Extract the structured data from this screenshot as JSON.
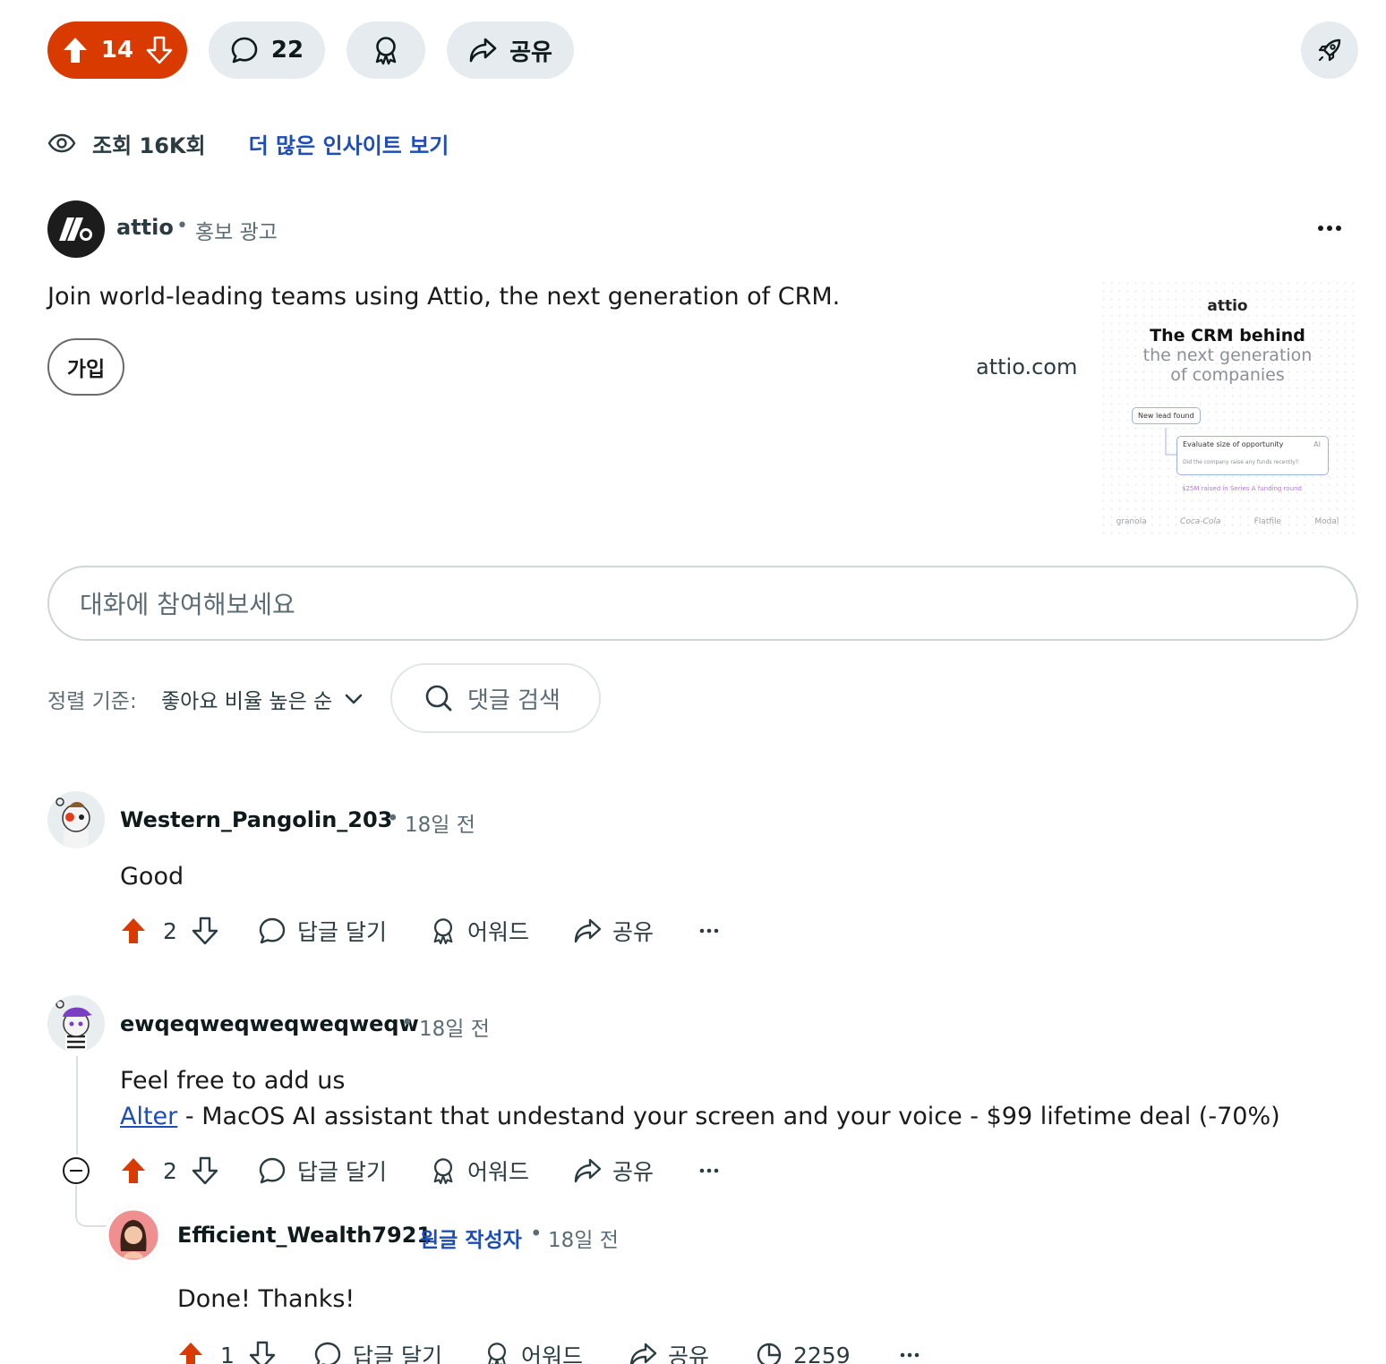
{
  "post_actions": {
    "score": "14",
    "comments_count": "22",
    "share_label": "공유"
  },
  "insights": {
    "views": "조회 16K회",
    "more_insights": "더 많은 인사이트 보기"
  },
  "ad": {
    "advertiser": "attio",
    "separator": "•",
    "promo_label": "홍보 광고",
    "body": "Join world-leading teams using Attio, the next generation of CRM.",
    "cta_label": "가입",
    "domain": "attio.com",
    "creative": {
      "logo": "attio",
      "headline_1": "The CRM behind",
      "headline_2": "the next generation",
      "headline_3": "of companies",
      "box_1": "New lead found",
      "box_2": "Evaluate size of opportunity",
      "box_2_tag": "AI",
      "box_2_question": "Did the company raise any funds recently?",
      "box_3": "$25M raised in Series A funding round",
      "logos": [
        "granola",
        "Coca-Cola",
        "Flatfile",
        "Modal"
      ]
    }
  },
  "composer": {
    "placeholder": "대화에 참여해보세요"
  },
  "sort": {
    "label": "정렬 기준:",
    "value": "좋아요 비율 높은 순",
    "search_label": "댓글 검색"
  },
  "actions": {
    "reply": "답글 달기",
    "award": "어워드",
    "share": "공유"
  },
  "comments": [
    {
      "author": "Western_Pangolin_203",
      "separator": "•",
      "time": "18일 전",
      "body": "Good",
      "score": "2"
    },
    {
      "author": "ewqeqweqweqweqweqw",
      "separator": "•",
      "time": "18일 전",
      "body_line1": "Feel free to add us",
      "link_text": "Alter",
      "body_line2_rest": " - MacOS AI assistant that undestand your screen and your voice - $99 lifetime deal (-70%)",
      "score": "2"
    },
    {
      "author": "Efficient_Wealth7921",
      "op_badge": "원글 작성자",
      "separator": "•",
      "time": "18일 전",
      "body": "Done! Thanks!",
      "score": "1",
      "view_count": "2259"
    }
  ],
  "colors": {
    "upvote": "#d93a00",
    "link": "#1e4db7",
    "pill_bg": "#e5ebee"
  }
}
